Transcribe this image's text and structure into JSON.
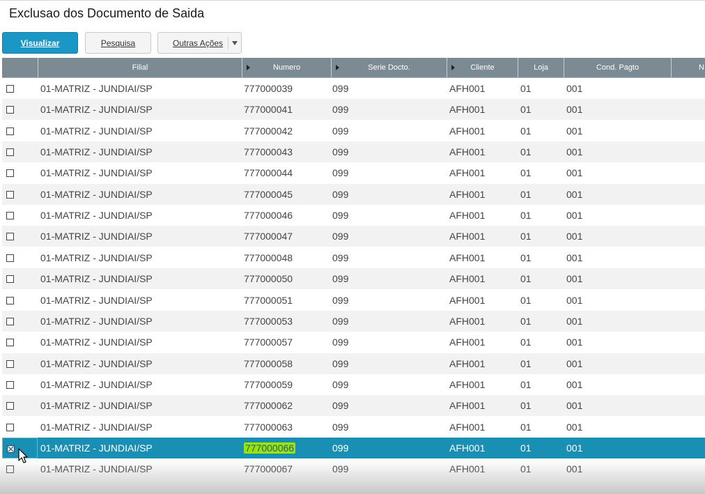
{
  "page": {
    "title": "Exclusao dos Documento de Saida"
  },
  "toolbar": {
    "visualizar_label": "Visualizar",
    "pesquisa_label": "Pesquisa",
    "outras_acoes_label": "Outras Ações"
  },
  "grid": {
    "columns": {
      "filial": "Filial",
      "numero": "Numero",
      "serie": "Serie Docto.",
      "cliente": "Cliente",
      "loja": "Loja",
      "cond_pagto": "Cond. Pagto",
      "next_partial": "N"
    },
    "rows": [
      {
        "filial": "01-MATRIZ - JUNDIAI/SP",
        "numero": "777000039",
        "serie": "099",
        "cliente": "AFH001",
        "loja": "01",
        "cond": "001"
      },
      {
        "filial": "01-MATRIZ - JUNDIAI/SP",
        "numero": "777000041",
        "serie": "099",
        "cliente": "AFH001",
        "loja": "01",
        "cond": "001"
      },
      {
        "filial": "01-MATRIZ - JUNDIAI/SP",
        "numero": "777000042",
        "serie": "099",
        "cliente": "AFH001",
        "loja": "01",
        "cond": "001"
      },
      {
        "filial": "01-MATRIZ - JUNDIAI/SP",
        "numero": "777000043",
        "serie": "099",
        "cliente": "AFH001",
        "loja": "01",
        "cond": "001"
      },
      {
        "filial": "01-MATRIZ - JUNDIAI/SP",
        "numero": "777000044",
        "serie": "099",
        "cliente": "AFH001",
        "loja": "01",
        "cond": "001"
      },
      {
        "filial": "01-MATRIZ - JUNDIAI/SP",
        "numero": "777000045",
        "serie": "099",
        "cliente": "AFH001",
        "loja": "01",
        "cond": "001"
      },
      {
        "filial": "01-MATRIZ - JUNDIAI/SP",
        "numero": "777000046",
        "serie": "099",
        "cliente": "AFH001",
        "loja": "01",
        "cond": "001"
      },
      {
        "filial": "01-MATRIZ - JUNDIAI/SP",
        "numero": "777000047",
        "serie": "099",
        "cliente": "AFH001",
        "loja": "01",
        "cond": "001"
      },
      {
        "filial": "01-MATRIZ - JUNDIAI/SP",
        "numero": "777000048",
        "serie": "099",
        "cliente": "AFH001",
        "loja": "01",
        "cond": "001"
      },
      {
        "filial": "01-MATRIZ - JUNDIAI/SP",
        "numero": "777000050",
        "serie": "099",
        "cliente": "AFH001",
        "loja": "01",
        "cond": "001"
      },
      {
        "filial": "01-MATRIZ - JUNDIAI/SP",
        "numero": "777000051",
        "serie": "099",
        "cliente": "AFH001",
        "loja": "01",
        "cond": "001"
      },
      {
        "filial": "01-MATRIZ - JUNDIAI/SP",
        "numero": "777000053",
        "serie": "099",
        "cliente": "AFH001",
        "loja": "01",
        "cond": "001"
      },
      {
        "filial": "01-MATRIZ - JUNDIAI/SP",
        "numero": "777000057",
        "serie": "099",
        "cliente": "AFH001",
        "loja": "01",
        "cond": "001"
      },
      {
        "filial": "01-MATRIZ - JUNDIAI/SP",
        "numero": "777000058",
        "serie": "099",
        "cliente": "AFH001",
        "loja": "01",
        "cond": "001"
      },
      {
        "filial": "01-MATRIZ - JUNDIAI/SP",
        "numero": "777000059",
        "serie": "099",
        "cliente": "AFH001",
        "loja": "01",
        "cond": "001"
      },
      {
        "filial": "01-MATRIZ - JUNDIAI/SP",
        "numero": "777000062",
        "serie": "099",
        "cliente": "AFH001",
        "loja": "01",
        "cond": "001"
      },
      {
        "filial": "01-MATRIZ - JUNDIAI/SP",
        "numero": "777000063",
        "serie": "099",
        "cliente": "AFH001",
        "loja": "01",
        "cond": "001"
      },
      {
        "filial": "01-MATRIZ - JUNDIAI/SP",
        "numero": "777000066",
        "serie": "099",
        "cliente": "AFH001",
        "loja": "01",
        "cond": "001",
        "selected": true,
        "checked": true
      },
      {
        "filial": "01-MATRIZ - JUNDIAI/SP",
        "numero": "777000067",
        "serie": "099",
        "cliente": "AFH001",
        "loja": "01",
        "cond": "001"
      }
    ]
  }
}
